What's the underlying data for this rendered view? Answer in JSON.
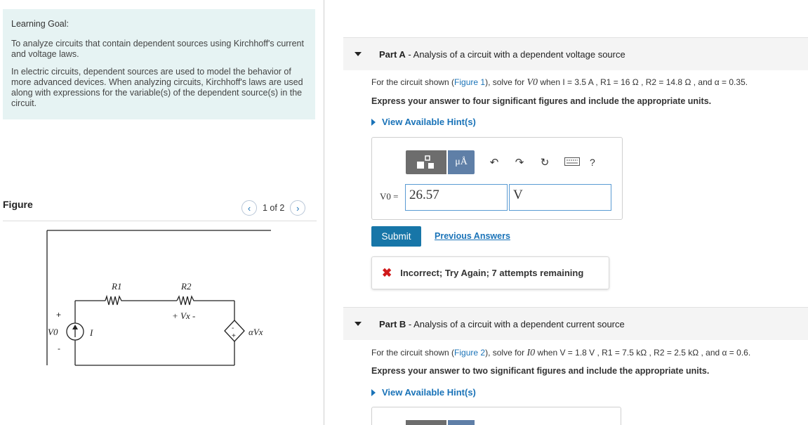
{
  "learning_goal": {
    "title": "Learning Goal:",
    "p1": "To analyze circuits that contain dependent sources using Kirchhoff's current and voltage laws.",
    "p2": "In electric circuits, dependent sources are used to model the behavior of more advanced devices. When analyzing circuits, Kirchhoff's laws are used along with expressions for the variable(s) of the dependent source(s) in the circuit."
  },
  "figure": {
    "label": "Figure",
    "pager_text": "1 of 2",
    "prev_icon": "chevron-left-icon",
    "next_icon": "chevron-right-icon",
    "circuit": {
      "r1": "R1",
      "r2": "R2",
      "vx": "+ Vx -",
      "v0": "V0",
      "current": "I",
      "dep_source": "αVx",
      "plus": "+",
      "minus": "-"
    }
  },
  "part_a": {
    "label": "Part A",
    "title": " - Analysis of a circuit with a dependent voltage source",
    "problem_pre": "For the circuit shown (",
    "figure_link": "Figure 1",
    "problem_mid": "), solve for ",
    "target": "V0",
    "problem_when": " when ",
    "given": "I = 3.5 A , R1 = 16 Ω , R2 = 14.8 Ω , and α = 0.35.",
    "instruction": "Express your answer to four significant figures and include the appropriate units.",
    "hint": "View Available Hint(s)",
    "toolbar": {
      "template_icon": "template-icon",
      "units_label": "μÅ",
      "undo_icon": "undo-icon",
      "redo_icon": "redo-icon",
      "reset_icon": "reset-icon",
      "keyboard_icon": "keyboard-icon",
      "help_label": "?"
    },
    "answer_label": "V0 =",
    "answer_value": "26.57",
    "answer_units": "V",
    "submit": "Submit",
    "previous_answers": "Previous Answers",
    "feedback": "Incorrect; Try Again; 7 attempts remaining"
  },
  "part_b": {
    "label": "Part B",
    "title": " - Analysis of a circuit with a dependent current source",
    "problem_pre": "For the circuit shown (",
    "figure_link": "Figure 2",
    "problem_mid": "), solve for ",
    "target": "I0",
    "problem_when": " when ",
    "given": "V = 1.8 V , R1 = 7.5 kΩ , R2 = 2.5 kΩ , and α = 0.6.",
    "instruction": "Express your answer to two significant figures and include the appropriate units.",
    "hint": "View Available Hint(s)"
  }
}
